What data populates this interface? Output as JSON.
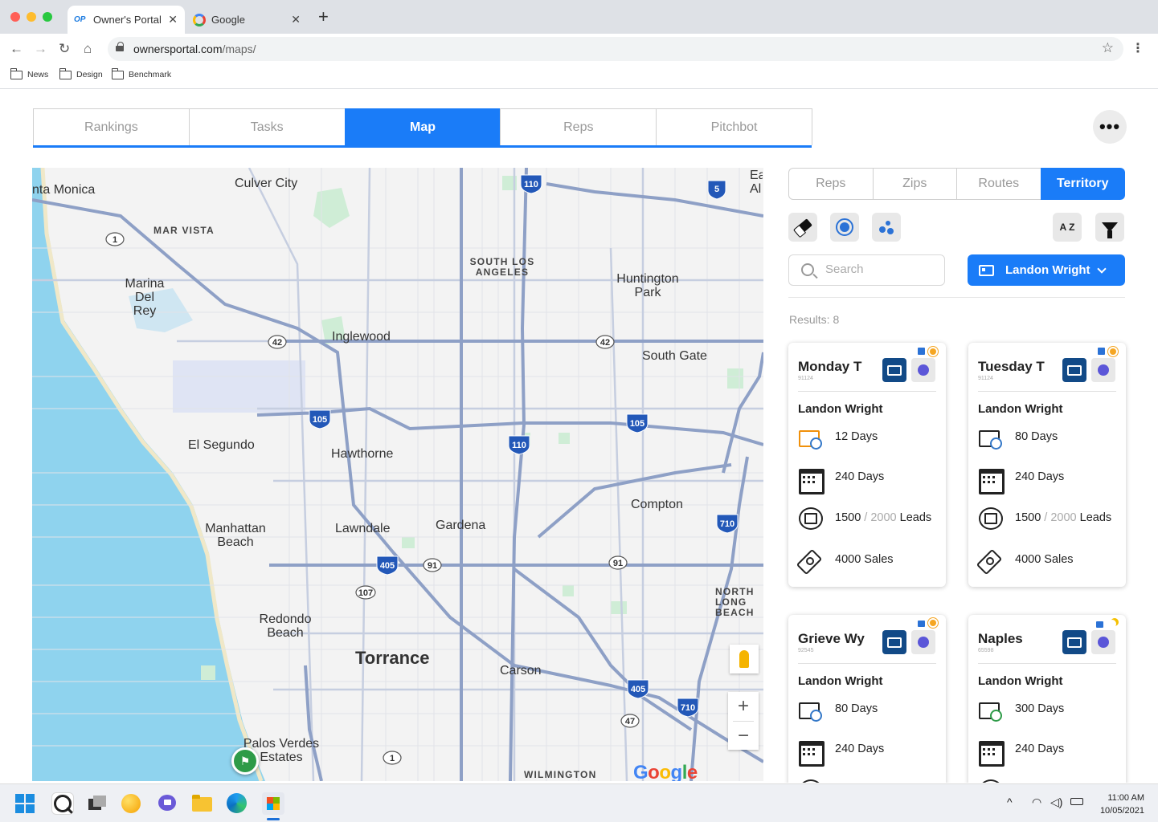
{
  "browser": {
    "tabs": [
      {
        "favicon": "owners-portal-favicon",
        "favicon_text": "OP",
        "title": "Owner's Portal",
        "active": true
      },
      {
        "favicon": "google-favicon",
        "title": "Google",
        "active": false
      }
    ],
    "close_glyph": "✕",
    "new_tab_glyph": "+",
    "url_host": "ownersportal.com",
    "url_path": "/maps/",
    "bookmarks": [
      "News",
      "Design",
      "Benchmark"
    ]
  },
  "app": {
    "main_tabs": [
      "Rankings",
      "Tasks",
      "Map",
      "Reps",
      "Pitchbot"
    ],
    "main_tab_active": "Map",
    "more_glyph": "•••",
    "sub_tabs": [
      "Reps",
      "Zips",
      "Routes",
      "Territory"
    ],
    "sub_tab_active": "Territory",
    "tools": [
      "eraser-icon",
      "circle-select-icon",
      "multi-select-icon",
      "sort-az-icon",
      "filter-icon"
    ],
    "sort_label": "A Z",
    "search_placeholder": "Search",
    "selected_user": "Landon Wright",
    "results_label": "Results: 8"
  },
  "map": {
    "labels": [
      "nta Monica",
      "Culver City",
      "MAR VISTA",
      "Marina Del Rey",
      "SOUTH LOS ANGELES",
      "Huntington Park",
      "Inglewood",
      "South Gate",
      "El Segundo",
      "Hawthorne",
      "Compton",
      "Manhattan Beach",
      "Lawndale",
      "Gardena",
      "NORTH LONG BEACH",
      "Redondo Beach",
      "Torrance",
      "Carson",
      "Palos Verdes Estates",
      "WILMINGTON",
      "Ea Al"
    ],
    "shields": [
      "1",
      "42",
      "42",
      "105",
      "105",
      "110",
      "110",
      "5",
      "710",
      "710",
      "405",
      "405",
      "91",
      "91",
      "107",
      "47",
      "1"
    ],
    "zoom_in": "+",
    "zoom_out": "−",
    "brand": "Google",
    "brand_colors": [
      "#4285f4",
      "#ea4335",
      "#fbbc05",
      "#4285f4",
      "#34a853",
      "#ea4335"
    ]
  },
  "territories": [
    {
      "name": "Monday T",
      "zip": "91124",
      "rep": "Landon Wright",
      "badges": [
        "user-badge-icon",
        "sun-icon"
      ],
      "days_left": "12 Days",
      "days_left_color": "orange",
      "days_total": "240 Days",
      "leads_done": "1500",
      "leads_sep": " / ",
      "leads_total": "2000",
      "leads_unit": " Leads",
      "sales": "4000 Sales"
    },
    {
      "name": "Tuesday T",
      "zip": "91124",
      "rep": "Landon Wright",
      "badges": [
        "user-badge-icon",
        "sun-icon"
      ],
      "days_left": "80 Days",
      "days_left_color": "blue",
      "days_total": "240 Days",
      "leads_done": "1500",
      "leads_sep": " / ",
      "leads_total": "2000",
      "leads_unit": " Leads",
      "sales": "4000 Sales"
    },
    {
      "name": "Grieve Wy",
      "zip": "92545",
      "rep": "Landon Wright",
      "badges": [
        "briefcase-badge-icon",
        "sun-icon"
      ],
      "days_left": "80 Days",
      "days_left_color": "blue",
      "days_total": "240 Days"
    },
    {
      "name": "Naples",
      "zip": "65598",
      "rep": "Landon Wright",
      "badges": [
        "briefcase-badge-icon",
        "moon-icon"
      ],
      "days_left": "300 Days",
      "days_left_color": "green",
      "days_total": "240 Days"
    }
  ],
  "taskbar": {
    "apps": [
      "windows-start-icon",
      "search-icon",
      "task-view-icon",
      "widgets-icon",
      "chat-icon",
      "file-explorer-icon",
      "edge-icon",
      "store-icon"
    ],
    "tray_chevron": "^",
    "time": "11:00 AM",
    "date": "10/05/2021"
  }
}
